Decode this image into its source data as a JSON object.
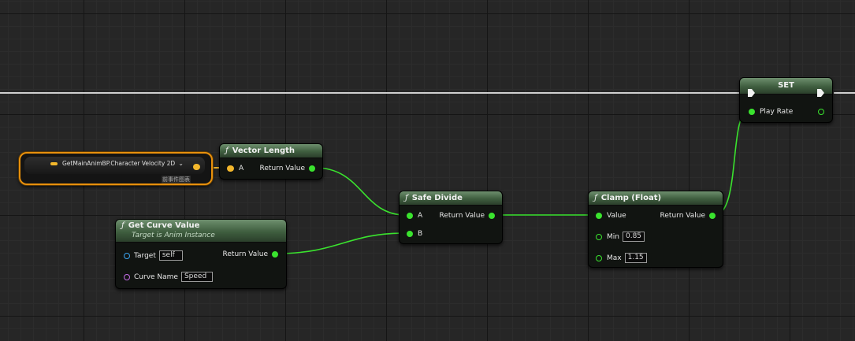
{
  "nodes": {
    "var_get": {
      "label": "GetMainAnimBP.Character Velocity 2D",
      "caption": "前事件图表"
    },
    "vector_length": {
      "title": "Vector Length",
      "in_a": "A",
      "out": "Return Value"
    },
    "get_curve": {
      "title": "Get Curve Value",
      "subtitle": "Target is Anim Instance",
      "target_label": "Target",
      "target_value": "self",
      "curve_label": "Curve Name",
      "curve_value": "Speed",
      "out": "Return Value"
    },
    "safe_divide": {
      "title": "Safe Divide",
      "in_a": "A",
      "in_b": "B",
      "out": "Return Value"
    },
    "clamp": {
      "title": "Clamp (Float)",
      "in_value": "Value",
      "min_label": "Min",
      "min_value": "0.85",
      "max_label": "Max",
      "max_value": "1.15",
      "out": "Return Value"
    },
    "set": {
      "title": "SET",
      "in_play": "Play Rate"
    }
  },
  "colors": {
    "float_pin": "#3ae32e",
    "vector_pin": "#f3b72c",
    "object_pin": "#3ba4ef",
    "name_pin": "#c46ce6",
    "exec_wire": "#d0d0d0",
    "selection": "#e8900c"
  }
}
